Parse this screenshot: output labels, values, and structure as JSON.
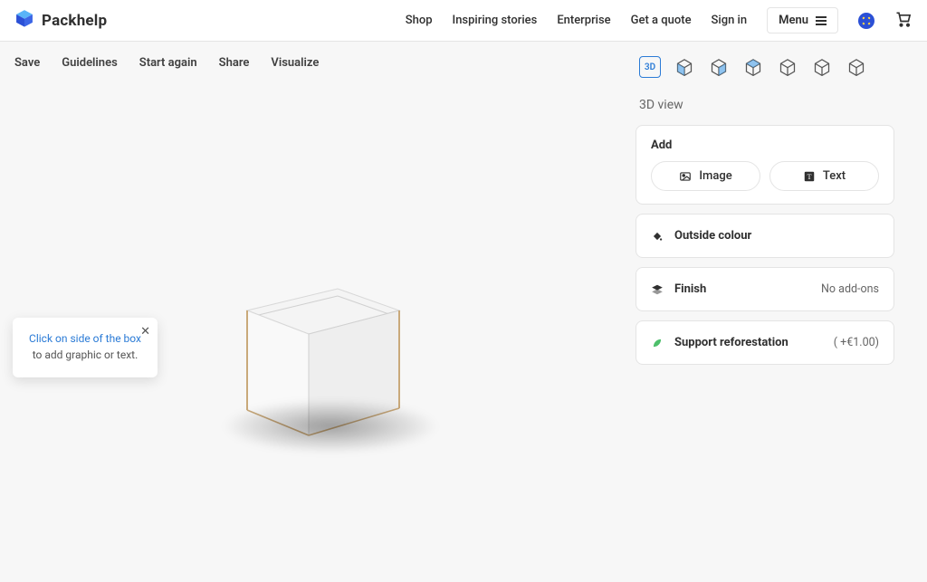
{
  "brand": "Packhelp",
  "nav": {
    "shop": "Shop",
    "stories": "Inspiring stories",
    "enterprise": "Enterprise",
    "quote": "Get a quote",
    "signin": "Sign in",
    "menu": "Menu"
  },
  "toolbar": {
    "save": "Save",
    "guidelines": "Guidelines",
    "start_again": "Start again",
    "share": "Share",
    "visualize": "Visualize"
  },
  "tooltip": {
    "highlight": "Click on side of the box",
    "rest": " to add graphic or text."
  },
  "views": {
    "active_label": "3D",
    "section_title": "3D view"
  },
  "add_panel": {
    "heading": "Add",
    "image": "Image",
    "text": "Text"
  },
  "rows": {
    "outside_colour": "Outside colour",
    "finish": "Finish",
    "finish_value": "No add-ons",
    "reforest": "Support reforestation",
    "reforest_value": "( +€1.00)"
  }
}
